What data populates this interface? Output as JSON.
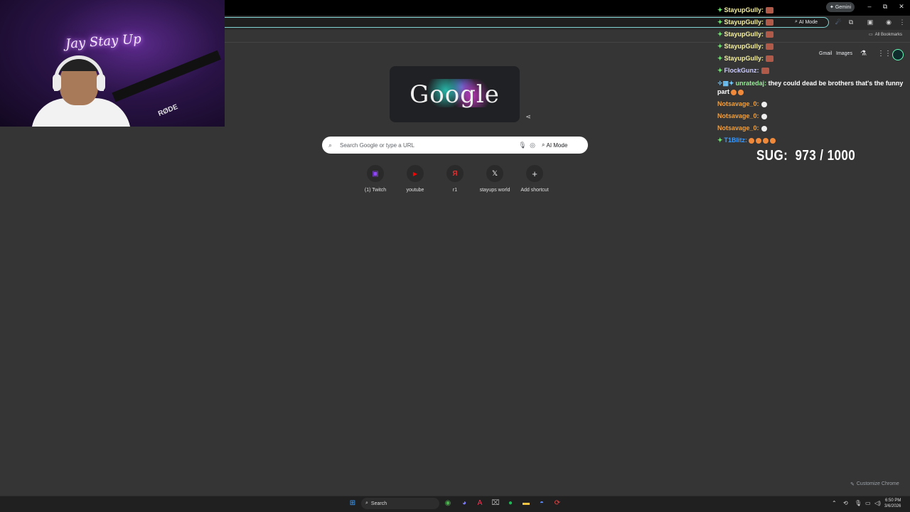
{
  "browser": {
    "gemini_label": "Gemini",
    "ai_mode_label": "AI Mode",
    "all_bookmarks": "All Bookmarks",
    "window_controls": {
      "minimize": "–",
      "restore": "⧉",
      "close": "✕"
    }
  },
  "webcam": {
    "neon_sign": "Jay Stay Up",
    "mic_brand": "RØDE"
  },
  "newtab": {
    "search_placeholder": "Search Google or type a URL",
    "ai_mode_label": "AI Mode",
    "top_links": {
      "gmail": "Gmail",
      "images": "Images"
    },
    "shortcuts": [
      {
        "label": "(1) Twitch",
        "icon": "twitch-icon",
        "color": "#9146ff",
        "glyph": "▣"
      },
      {
        "label": "youtube",
        "icon": "youtube-icon",
        "color": "#ff0000",
        "glyph": "▶"
      },
      {
        "label": "r1",
        "icon": "r1-icon",
        "color": "#e03030",
        "glyph": "Я"
      },
      {
        "label": "stayups world",
        "icon": "x-icon",
        "color": "#ffffff",
        "glyph": "𝕏"
      },
      {
        "label": "Add shortcut",
        "icon": "plus-icon",
        "color": "#e8eaed",
        "glyph": "+"
      }
    ],
    "customize_label": "Customize Chrome"
  },
  "chat": {
    "messages": [
      {
        "user": "StayupGully:",
        "color": "#f5f0a0",
        "badge": "✦",
        "text": "",
        "emote": "face"
      },
      {
        "user": "StayupGully:",
        "color": "#f5f0a0",
        "badge": "✦",
        "text": "",
        "emote": "face"
      },
      {
        "user": "StayupGully:",
        "color": "#f5f0a0",
        "badge": "✦",
        "text": "",
        "emote": "face"
      },
      {
        "user": "StayupGully:",
        "color": "#f5f0a0",
        "badge": "✦",
        "text": "",
        "emote": "face"
      },
      {
        "user": "StayupGully:",
        "color": "#f5f0a0",
        "badge": "✦",
        "text": "",
        "emote": "face"
      },
      {
        "user": "FlockGunz:",
        "color": "#c9c9ff",
        "badge": "✦",
        "text": "",
        "emote": "face"
      },
      {
        "user": "unratedaj:",
        "color": "#9be89b",
        "badge": "✧▦✦",
        "text": "they could dead be brothers that's the funny part",
        "emote": "laugh2",
        "wrap": true
      },
      {
        "user": "Notsavage_0:",
        "color": "#f0a040",
        "badge": "",
        "text": "",
        "emote": "white"
      },
      {
        "user": "Notsavage_0:",
        "color": "#f0a040",
        "badge": "",
        "text": "",
        "emote": "white"
      },
      {
        "user": "Notsavage_0:",
        "color": "#f0a040",
        "badge": "",
        "text": "",
        "emote": "white"
      },
      {
        "user": "T1Blitz:",
        "color": "#3b9bff",
        "badge": "✦",
        "text": "",
        "emote": "laugh4"
      }
    ],
    "sug_label": "SUG:",
    "sug_value": "973 / 1000"
  },
  "taskbar": {
    "search_label": "Search",
    "time": "6:50 PM",
    "date": "3/6/2026"
  }
}
